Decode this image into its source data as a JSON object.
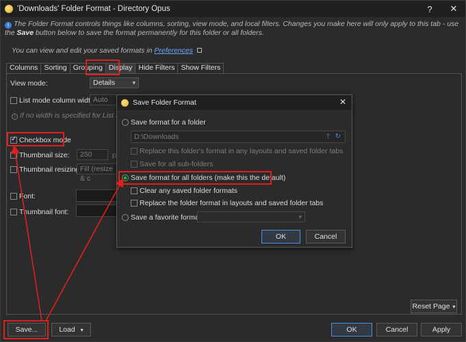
{
  "window": {
    "title": "'Downloads' Folder Format - Directory Opus",
    "help": "?",
    "close": "✕"
  },
  "info": {
    "text_before": "The Folder Format controls things like columns, sorting, view mode, and local filters. Changes you make here will only apply to this tab - use the ",
    "text_bold": "Save",
    "text_after": " button below to save the format permanently for this folder or all folders.",
    "pref_text": "You can view and edit your saved formats in ",
    "pref_link": "Preferences"
  },
  "tabs": [
    "Columns",
    "Sorting",
    "Grouping",
    "Display",
    "Hide Filters",
    "Show Filters"
  ],
  "display": {
    "view_mode_label": "View mode:",
    "view_mode_value": "Details",
    "list_width_label": "List mode column width:",
    "list_width_value": "Auto",
    "list_hint": "If no width is specified for List mode,",
    "checkbox_mode_label": "Checkbox mode",
    "thumb_size_label": "Thumbnail size:",
    "thumb_size_value": "250",
    "thumb_size_unit": "p",
    "thumb_resize_label": "Thumbnail resizing:",
    "thumb_resize_value": "Fill (resize & c",
    "font_label": "Font:",
    "thumb_font_label": "Thumbnail font:"
  },
  "dialog": {
    "title": "Save Folder Format",
    "opt_folder": "Save format for a folder",
    "folder_path": "D:\\Downloads",
    "replace_layouts": "Replace this folder's format in any layouts and saved folder tabs",
    "save_subfolders": "Save for all sub-folders",
    "opt_all": "Save format for all folders (make this the default)",
    "clear_saved": "Clear any saved folder formats",
    "replace_folder_format": "Replace the folder format in layouts and saved folder tabs",
    "opt_favorite": "Save a favorite format:",
    "ok": "OK",
    "cancel": "Cancel"
  },
  "footer": {
    "reset_page": "Reset Page",
    "save": "Save...",
    "load": "Load",
    "ok": "OK",
    "cancel": "Cancel",
    "apply": "Apply"
  },
  "colors": {
    "highlight": "#e01f1f",
    "radio_selected": "#3fb34f",
    "link": "#6aa6ff"
  }
}
